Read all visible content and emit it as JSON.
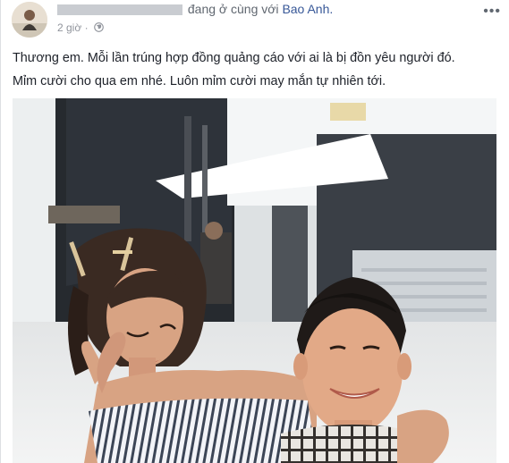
{
  "post": {
    "author_name_obscured": true,
    "with_text": "đang ở cùng với",
    "tagged_name": "Bao Anh.",
    "timestamp": "2 giờ",
    "privacy_icon": "globe-icon",
    "more_icon": "more-options-icon",
    "lines": [
      "Thương em. Mỗi lần trúng hợp đồng quảng cáo với ai là bị đồn yêu người đó.",
      "Mỉm cười cho qua em nhé. Luôn mỉm cười may mắn tự nhiên tới."
    ]
  },
  "colors": {
    "link": "#385898",
    "meta": "#90949c",
    "text": "#1d2129"
  }
}
